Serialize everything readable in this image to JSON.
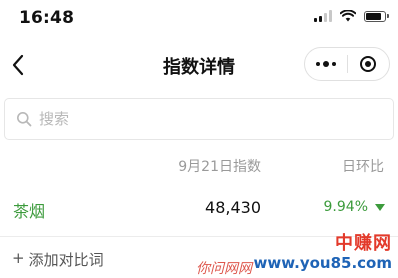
{
  "status_bar": {
    "time": "16:48"
  },
  "nav": {
    "title": "指数详情"
  },
  "search": {
    "placeholder": "搜索",
    "value": ""
  },
  "table": {
    "columns": {
      "index": "9月21日指数",
      "change": "日环比"
    },
    "rows": [
      {
        "name": "茶烟",
        "value": "48,430",
        "change": "9.94%",
        "direction": "down"
      }
    ]
  },
  "actions": {
    "add_compare_plus": "+",
    "add_compare_label": "添加对比词"
  },
  "watermark": {
    "brand": "中赚网",
    "site": "www.you85.com",
    "slogan": "你问网网"
  },
  "colors": {
    "accent_green": "#3c9b3c",
    "muted_text": "#9a9a9a",
    "watermark_red": "#e33a2b",
    "watermark_blue": "#1e63b6"
  }
}
